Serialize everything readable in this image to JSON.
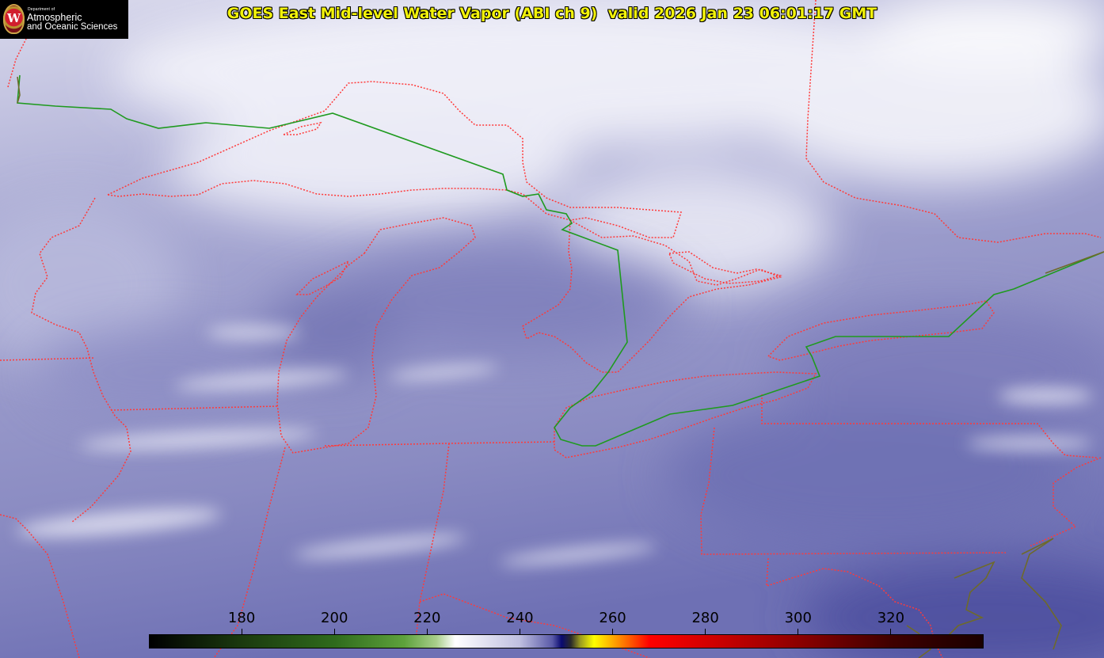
{
  "title": "GOES East Mid-level Water Vapor (ABI ch 9)  valid 2026 Jan 23 06:01:17 GMT",
  "logo": {
    "seal_letter": "W",
    "dept": "Department of",
    "line1": "Atmospheric",
    "line2": "and Oceanic Sciences"
  },
  "colorbar": {
    "min": 160,
    "max": 340,
    "ticks": [
      "180",
      "200",
      "220",
      "240",
      "260",
      "280",
      "300",
      "320"
    ],
    "tick_values": [
      180,
      200,
      220,
      240,
      260,
      280,
      300,
      320
    ],
    "stops": [
      {
        "value": 160,
        "color": "#000000"
      },
      {
        "value": 180,
        "color": "#1b3a0f"
      },
      {
        "value": 200,
        "color": "#2f6b1c"
      },
      {
        "value": 215,
        "color": "#5ea23c"
      },
      {
        "value": 222,
        "color": "#a9cf8c"
      },
      {
        "value": 226,
        "color": "#ffffff"
      },
      {
        "value": 240,
        "color": "#bfbfe0"
      },
      {
        "value": 247,
        "color": "#5a5aa8"
      },
      {
        "value": 249,
        "color": "#0a0a70"
      },
      {
        "value": 251,
        "color": "#2a2a2a"
      },
      {
        "value": 253,
        "color": "#9a9a20"
      },
      {
        "value": 256,
        "color": "#ffff00"
      },
      {
        "value": 262,
        "color": "#ff8000"
      },
      {
        "value": 268,
        "color": "#ff0000"
      },
      {
        "value": 295,
        "color": "#a00000"
      },
      {
        "value": 320,
        "color": "#400000"
      },
      {
        "value": 340,
        "color": "#1a0000"
      }
    ]
  },
  "colors": {
    "state_border": "#ff3a3a",
    "country_border": "#1f9a1f",
    "title_text": "#f2f20a",
    "image_base": "#8f90c4"
  }
}
